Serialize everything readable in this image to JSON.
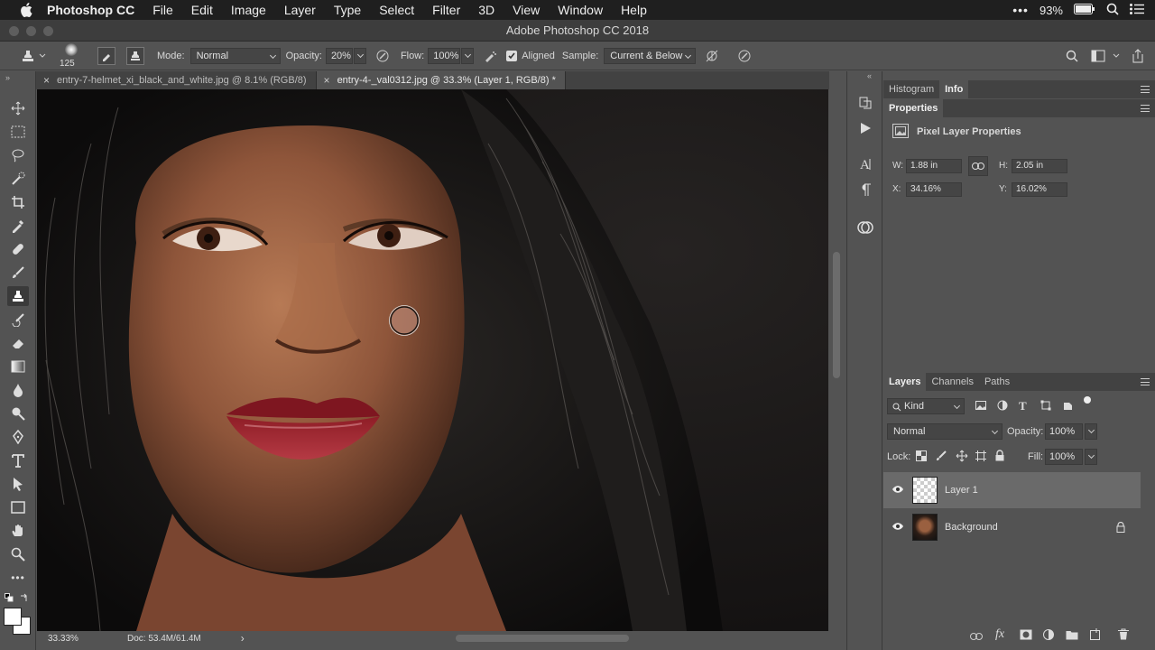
{
  "menubar": {
    "app_name": "Photoshop CC",
    "items": [
      "File",
      "Edit",
      "Image",
      "Layer",
      "Type",
      "Select",
      "Filter",
      "3D",
      "View",
      "Window",
      "Help"
    ],
    "battery": "93%"
  },
  "window": {
    "title": "Adobe Photoshop CC 2018"
  },
  "options": {
    "brush_size": "125",
    "mode_label": "Mode:",
    "mode_value": "Normal",
    "opacity_label": "Opacity:",
    "opacity_value": "20%",
    "flow_label": "Flow:",
    "flow_value": "100%",
    "aligned_label": "Aligned",
    "aligned_checked": true,
    "sample_label": "Sample:",
    "sample_value": "Current & Below"
  },
  "tabs": [
    {
      "label": "entry-7-helmet_xi_black_and_white.jpg @ 8.1% (RGB/8)",
      "active": false
    },
    {
      "label": "entry-4-_val0312.jpg @ 33.3% (Layer 1, RGB/8) *",
      "active": true
    }
  ],
  "status": {
    "zoom": "33.33%",
    "doc": "Doc: 53.4M/61.4M",
    "arrow": "›"
  },
  "panels": {
    "top_tabs": [
      "Histogram",
      "Info"
    ],
    "properties_title": "Properties",
    "pixel_layer_label": "Pixel Layer Properties",
    "w_label": "W:",
    "w_value": "1.88 in",
    "h_label": "H:",
    "h_value": "2.05 in",
    "x_label": "X:",
    "x_value": "34.16%",
    "y_label": "Y:",
    "y_value": "16.02%",
    "layers_tabs": [
      "Layers",
      "Channels",
      "Paths"
    ],
    "kind_label": "Kind",
    "blend_mode": "Normal",
    "opacity_label": "Opacity:",
    "opacity_value": "100%",
    "lock_label": "Lock:",
    "fill_label": "Fill:",
    "fill_value": "100%",
    "layers": [
      {
        "name": "Layer 1",
        "selected": true
      },
      {
        "name": "Background",
        "selected": false,
        "locked": true
      }
    ]
  },
  "colors": {
    "accent_selected": "#6a6a6a",
    "panel_bg": "#535353",
    "menubar_bg": "#1f1f1f"
  }
}
